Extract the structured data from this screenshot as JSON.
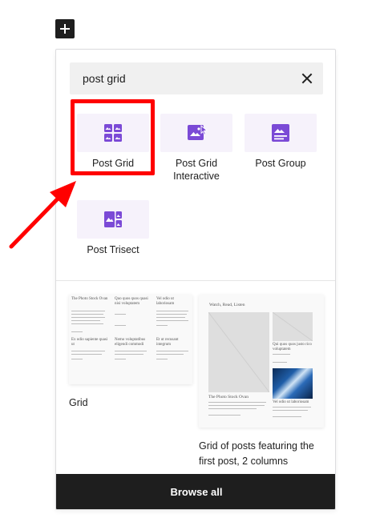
{
  "search": {
    "value": "post grid"
  },
  "blocks": [
    {
      "label": "Post Grid",
      "icon": "post-grid-icon"
    },
    {
      "label": "Post Grid Interactive",
      "icon": "post-grid-interactive-icon"
    },
    {
      "label": "Post Group",
      "icon": "post-group-icon"
    },
    {
      "label": "Post Trisect",
      "icon": "post-trisect-icon"
    }
  ],
  "patterns": [
    {
      "label": "Grid",
      "preview_titles": [
        "The Photo Stock Ovan",
        "Quo quos quos quasi nisi voluptatem",
        "Vel odio ut laboriosam",
        "Ex odio sapiente quasi ut",
        "Nemo voluptatibus eligendi commodi",
        "Et ut recusant integrum"
      ]
    },
    {
      "label": "Grid of posts featuring the first post, 2 columns",
      "preview_heading": "Watch, Read, Listen",
      "preview_titles": [
        "The Photo Stock Ovan",
        "Qui quos quos justo rico voluptatem",
        "Vel odio ut laboriosam"
      ]
    }
  ],
  "footer": {
    "browse_label": "Browse all"
  },
  "colors": {
    "accent": "#7b4ad6",
    "tile_bg": "#f6f2fb",
    "highlight": "#ff0000",
    "footer_bg": "#1e1e1e"
  }
}
